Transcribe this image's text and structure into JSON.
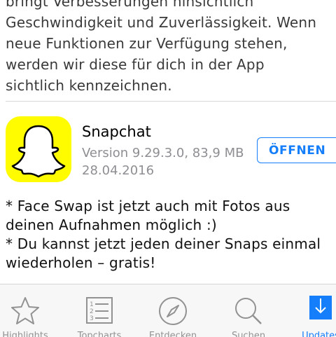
{
  "previous_notes": "bringt Verbesserungen hinsichtlich\nGeschwindigkeit und Zuverlässigkeit. Wenn\nneue Funktionen zur Verfügung stehen,\nwerden wir diese für dich in der App\nsichtlich kennzeichnen.",
  "app": {
    "name": "Snapchat",
    "meta": "Version 9.29.3.0, 83,9 MB",
    "date": "28.04.2016",
    "open_label": "ÖFFNEN",
    "icon_color": "#FFFC00"
  },
  "release_notes": "* Face Swap ist jetzt auch mit Fotos aus\ndeinen Aufnahmen möglich :)\n* Du kannst jetzt jeden deiner Snaps einmal\nwiederholen – gratis!",
  "tabbar": {
    "items": [
      {
        "label": "Highlights",
        "icon": "star-icon"
      },
      {
        "label": "Topcharts",
        "icon": "list-icon"
      },
      {
        "label": "Entdecken",
        "icon": "compass-icon"
      },
      {
        "label": "Suchen",
        "icon": "search-icon"
      },
      {
        "label": "Updates",
        "icon": "download-icon",
        "active": true
      }
    ]
  },
  "colors": {
    "accent": "#157EFB",
    "inactive": "#929292"
  }
}
